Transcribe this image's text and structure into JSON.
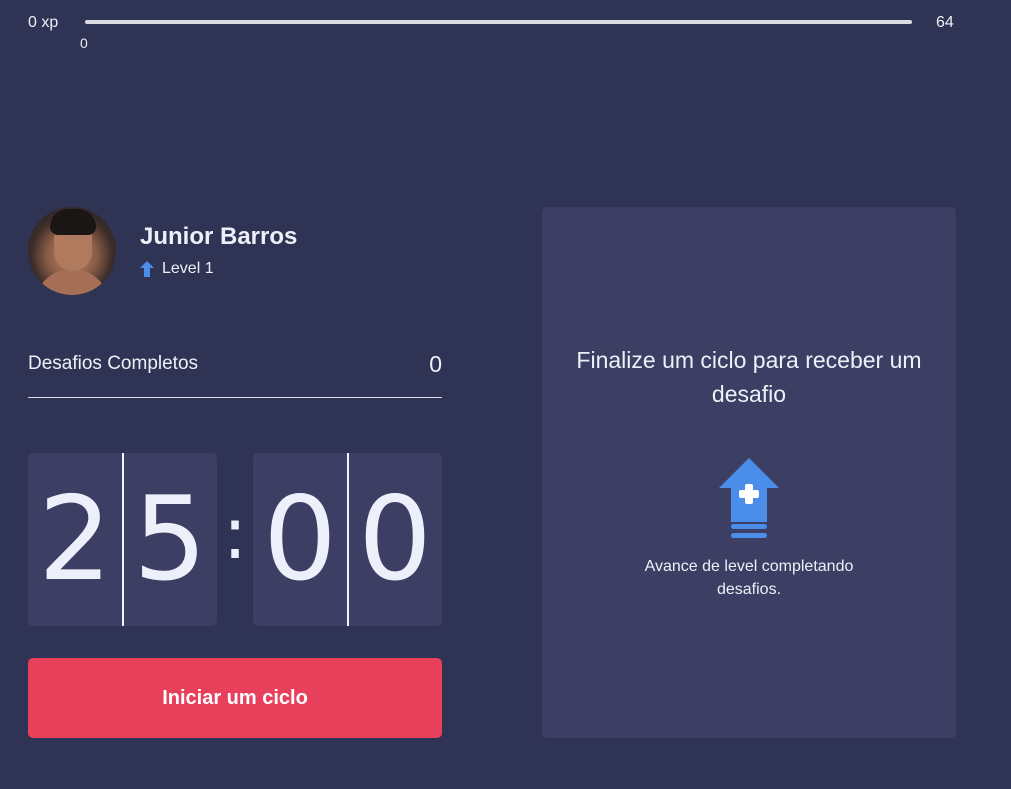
{
  "xp": {
    "min_label": "0 xp",
    "current_value": "0",
    "max_label": "64",
    "progress_fraction": 0
  },
  "profile": {
    "name": "Junior Barros",
    "level_label": "Level 1"
  },
  "challenges": {
    "label": "Desafios Completos",
    "count": "0"
  },
  "countdown": {
    "minute_left": "2",
    "minute_right": "5",
    "separator": ":",
    "second_left": "0",
    "second_right": "0"
  },
  "actions": {
    "start_label": "Iniciar um ciclo"
  },
  "challenge_card": {
    "title": "Finalize um ciclo para receber um desafio",
    "hint": "Avance de level completando desafios."
  },
  "colors": {
    "background": "#2f3354",
    "card": "#3c3f63",
    "accent_blue": "#4a8eea",
    "button_red": "#e83f5b",
    "xp_track": "#dcdde3"
  },
  "icons": {
    "level": "level-up-arrow-icon",
    "card": "level-up-arrow-plus-icon"
  }
}
